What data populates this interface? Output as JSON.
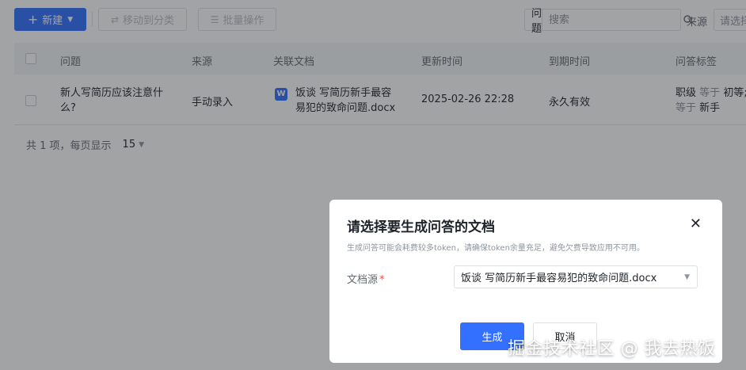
{
  "toolbar": {
    "new_label": "新建",
    "move_label": "移动到分类",
    "batch_label": "批量操作",
    "search_type": "问题",
    "search_placeholder": "搜索",
    "source_label": "来源",
    "source_placeholder": "请选择"
  },
  "table": {
    "headers": [
      "问题",
      "来源",
      "关联文档",
      "更新时间",
      "到期时间",
      "问答标签"
    ],
    "rows": [
      {
        "question_line1": "新人写简历应该注意什",
        "question_line2": "么?",
        "source": "手动录入",
        "doc_line1": "饭谈 写简历新手最容",
        "doc_line2": "易犯的致命问题.docx",
        "updated": "2025-02-26 22:28",
        "expiry": "永久有效",
        "tag1_key": "职级",
        "tag1_op": "等于",
        "tag1_val": "初等;",
        "tag2_op": "等于",
        "tag2_val": "新手"
      }
    ]
  },
  "pager": {
    "summary": "共 1 项，每页显示",
    "page_size": "15"
  },
  "modal": {
    "title": "请选择要生成问答的文档",
    "subtitle": "生成问答可能会耗费较多token，请确保token余量充足，避免欠费导致应用不可用。",
    "field_label": "文档源",
    "required_mark": "*",
    "selected_doc": "饭谈 写简历新手最容易犯的致命问题.docx",
    "generate_label": "生成",
    "cancel_label": "取消"
  },
  "watermark": "掘金技术社区 @ 我去热饭",
  "colors": {
    "primary": "#3370ff",
    "mask": "rgba(31,35,41,0.42)",
    "required": "#f54a45"
  }
}
